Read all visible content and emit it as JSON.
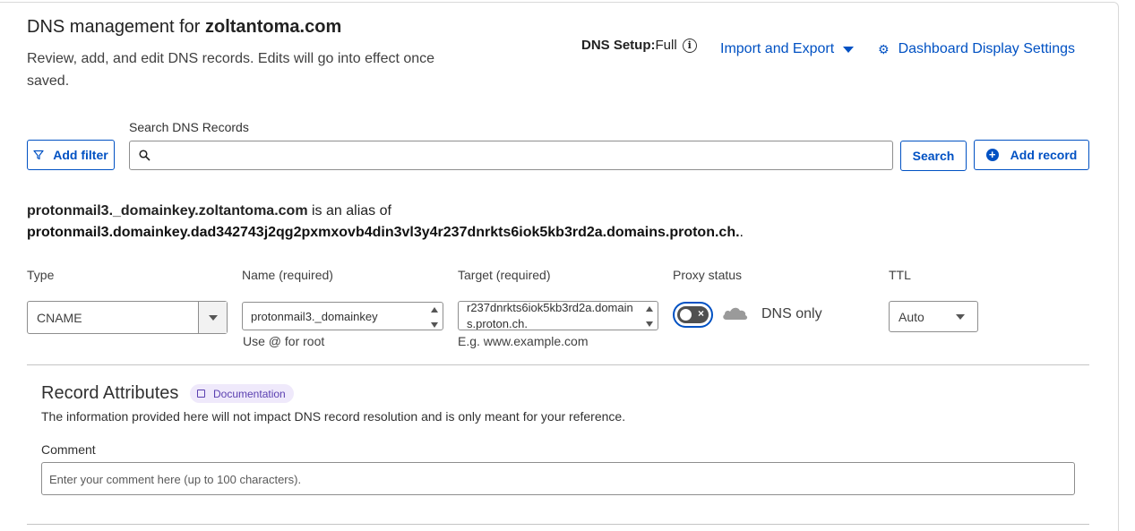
{
  "header": {
    "title_prefix": "DNS management for ",
    "domain": "zoltantoma.com",
    "subtitle": "Review, add, and edit DNS records. Edits will go into effect once saved.",
    "dns_setup_label": "DNS Setup:",
    "dns_setup_value": "Full",
    "info_glyph": "i",
    "import_export_label": "Import and Export",
    "display_settings_label": "Dashboard Display Settings"
  },
  "search": {
    "label": "Search DNS Records",
    "value": "",
    "add_filter_label": "Add filter",
    "search_button_label": "Search",
    "add_record_label": "Add record"
  },
  "alias": {
    "source": "protonmail3._domainkey.zoltantoma.com",
    "middle": " is an alias of",
    "target": "protonmail3.domainkey.dad342743j2qg2pxmxovb4din3vl3y4r237dnrkts6iok5kb3rd2a.domains.proton.ch.",
    "suffix": "."
  },
  "form": {
    "type_label": "Type",
    "type_value": "CNAME",
    "name_label": "Name (required)",
    "name_value": "protonmail3._domainkey",
    "name_hint": "Use @ for root",
    "target_label": "Target (required)",
    "target_value": "r237dnrkts6iok5kb3rd2a.domains.proton.ch.",
    "target_hint": "E.g. www.example.com",
    "proxy_label": "Proxy status",
    "proxy_value": "DNS only",
    "proxy_enabled": false,
    "ttl_label": "TTL",
    "ttl_value": "Auto"
  },
  "attributes": {
    "title": "Record Attributes",
    "doc_badge": "Documentation",
    "description": "The information provided here will not impact DNS record resolution and is only meant for your reference.",
    "comment_label": "Comment",
    "comment_placeholder": "Enter your comment here (up to 100 characters).",
    "comment_value": ""
  },
  "colors": {
    "accent": "#0051c3",
    "doc_badge_bg": "#efe9fb",
    "doc_badge_fg": "#5a3fb0",
    "toggle_off": "#505050"
  },
  "icons": {
    "filter": "funnel-icon",
    "search": "magnifier-icon",
    "add": "plus-circle-icon",
    "settings": "gear-icon",
    "dropdown": "caret-down-icon",
    "proxy": "cloud-icon",
    "documentation": "book-icon"
  }
}
